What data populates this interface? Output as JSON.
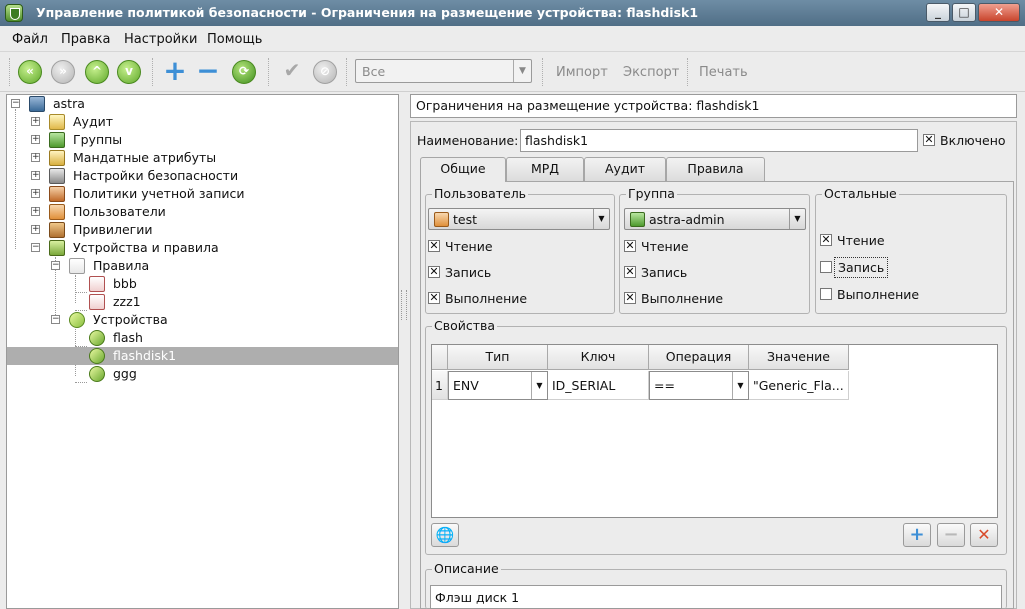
{
  "window": {
    "title": "Управление политикой безопасности - Ограничения на размещение устройства: flashdisk1",
    "minimize": "_",
    "maximize": "□",
    "close": "✕"
  },
  "menu": [
    "Файл",
    "Правка",
    "Настройки",
    "Помощь"
  ],
  "toolbar": {
    "filter_value": "Все",
    "import": "Импорт",
    "export": "Экспорт",
    "print": "Печать",
    "icons": [
      "back-icon",
      "forward-icon",
      "up-icon",
      "down-icon",
      "add-icon",
      "remove-icon",
      "refresh-icon",
      "apply-icon",
      "cancel-icon"
    ]
  },
  "tree": {
    "root": "astra",
    "items": [
      "Аудит",
      "Группы",
      "Мандатные атрибуты",
      "Настройки безопасности",
      "Политики учетной записи",
      "Пользователи",
      "Привилегии",
      "Устройства и правила"
    ],
    "rules_folder": "Правила",
    "rules": [
      "bbb",
      "zzz1"
    ],
    "devices_folder": "Устройства",
    "devices": [
      "flash",
      "flashdisk1",
      "ggg"
    ],
    "selected": "flashdisk1"
  },
  "header": {
    "title": "Ограничения на размещение устройства: flashdisk1"
  },
  "form": {
    "name_label": "Наименование:",
    "name_value": "flashdisk1",
    "enabled_label": "Включено",
    "enabled": true
  },
  "tabs": [
    "Общие",
    "МРД",
    "Аудит",
    "Правила"
  ],
  "active_tab": "Общие",
  "user_group": {
    "title": "Пользователь",
    "selected": "test",
    "read": "Чтение",
    "write": "Запись",
    "exec": "Выполнение",
    "read_checked": true,
    "write_checked": true,
    "exec_checked": true
  },
  "group_group": {
    "title": "Группа",
    "selected": "astra-admin",
    "read": "Чтение",
    "write": "Запись",
    "exec": "Выполнение",
    "read_checked": true,
    "write_checked": true,
    "exec_checked": true
  },
  "others_group": {
    "title": "Остальные",
    "read": "Чтение",
    "write": "Запись",
    "exec": "Выполнение",
    "read_checked": true,
    "write_checked": false,
    "exec_checked": false
  },
  "properties": {
    "title": "Свойства",
    "columns": [
      "Тип",
      "Ключ",
      "Операция",
      "Значение"
    ],
    "rows": [
      {
        "index": "1",
        "type": "ENV",
        "key": "ID_SERIAL",
        "operation": "==",
        "value": "\"Generic_Fla..."
      }
    ]
  },
  "description": {
    "title": "Описание",
    "value": "Флэш диск 1"
  },
  "colors": {
    "titlebar": "#5d7b93",
    "selection": "#aeaeae",
    "accent_blue": "#3d8fd6",
    "accent_green": "#5fa82a",
    "delete_red": "#c8442c"
  }
}
